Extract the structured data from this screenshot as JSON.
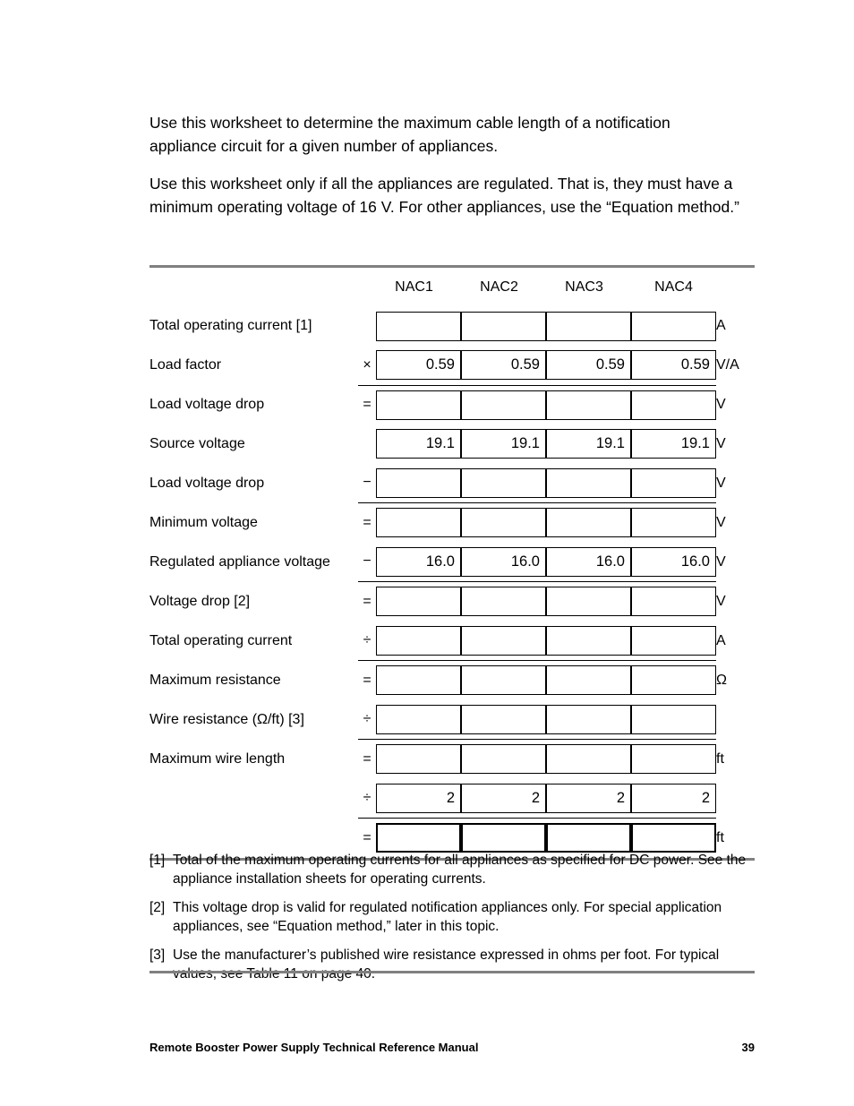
{
  "intro": {
    "paragraph_1": "Use this worksheet to determine the maximum cable length of a notification appliance circuit for a given number of appliances.",
    "paragraph_2": "Use this worksheet only if all the appliances are regulated. That is, they must have a minimum operating voltage of 16 V. For other appliances, use the “Equation method.”"
  },
  "worksheet": {
    "columns": [
      "NAC1",
      "NAC2",
      "NAC3",
      "NAC4"
    ],
    "rows": [
      {
        "label": "Total operating current [1]",
        "operator": "",
        "values": [
          "",
          "",
          "",
          ""
        ],
        "unit": "A",
        "separator_above": false,
        "bold_boxes": false
      },
      {
        "label": "Load factor",
        "operator": "×",
        "values": [
          "0.59",
          "0.59",
          "0.59",
          "0.59"
        ],
        "unit": "V/A",
        "separator_above": false,
        "bold_boxes": false
      },
      {
        "label": "Load voltage drop",
        "operator": "=",
        "values": [
          "",
          "",
          "",
          ""
        ],
        "unit": "V",
        "separator_above": true,
        "bold_boxes": false
      },
      {
        "label": "Source voltage",
        "operator": "",
        "values": [
          "19.1",
          "19.1",
          "19.1",
          "19.1"
        ],
        "unit": "V",
        "separator_above": false,
        "bold_boxes": false
      },
      {
        "label": "Load voltage drop",
        "operator": "−",
        "values": [
          "",
          "",
          "",
          ""
        ],
        "unit": "V",
        "separator_above": false,
        "bold_boxes": false
      },
      {
        "label": "Minimum voltage",
        "operator": "=",
        "values": [
          "",
          "",
          "",
          ""
        ],
        "unit": "V",
        "separator_above": true,
        "bold_boxes": false
      },
      {
        "label": "Regulated appliance voltage",
        "operator": "−",
        "values": [
          "16.0",
          "16.0",
          "16.0",
          "16.0"
        ],
        "unit": "V",
        "separator_above": false,
        "bold_boxes": false
      },
      {
        "label": "Voltage drop [2]",
        "operator": "=",
        "values": [
          "",
          "",
          "",
          ""
        ],
        "unit": "V",
        "separator_above": true,
        "bold_boxes": false
      },
      {
        "label": "Total operating current",
        "operator": "÷",
        "values": [
          "",
          "",
          "",
          ""
        ],
        "unit": "A",
        "separator_above": false,
        "bold_boxes": false
      },
      {
        "label": "Maximum resistance",
        "operator": "=",
        "values": [
          "",
          "",
          "",
          ""
        ],
        "unit": "Ω",
        "separator_above": true,
        "bold_boxes": false
      },
      {
        "label": "Wire resistance (Ω/ft) [3]",
        "operator": "÷",
        "values": [
          "",
          "",
          "",
          ""
        ],
        "unit": "",
        "separator_above": false,
        "bold_boxes": false
      },
      {
        "label": "Maximum wire length",
        "operator": "=",
        "values": [
          "",
          "",
          "",
          ""
        ],
        "unit": "ft",
        "separator_above": true,
        "bold_boxes": false
      },
      {
        "label": "",
        "operator": "÷",
        "values": [
          "2",
          "2",
          "2",
          "2"
        ],
        "unit": "",
        "separator_above": false,
        "bold_boxes": false
      },
      {
        "label": "",
        "operator": "=",
        "values": [
          "",
          "",
          "",
          ""
        ],
        "unit": "ft",
        "separator_above": true,
        "bold_boxes": true
      }
    ]
  },
  "footnotes": [
    {
      "marker": "[1]",
      "text": "Total of the maximum operating currents for all appliances as specified for DC power. See the appliance installation sheets for operating currents."
    },
    {
      "marker": "[2]",
      "text": "This voltage drop is valid for regulated notification appliances only. For special application appliances, see “Equation method,” later in this topic."
    },
    {
      "marker": "[3]",
      "text": "Use the manufacturer’s published wire resistance expressed in ohms per foot. For typical values, see Table 11 on page 40."
    }
  ],
  "page_footer": {
    "title": "Remote Booster Power Supply Technical Reference Manual",
    "page_number": "39"
  }
}
